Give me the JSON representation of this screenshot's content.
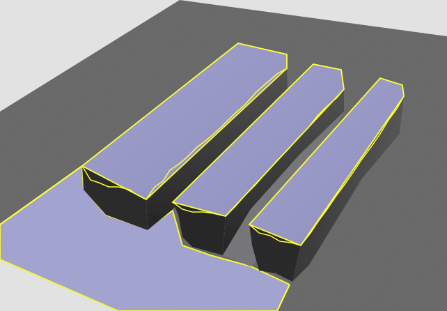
{
  "scene": {
    "background": "#e2e2e2",
    "ground_color": "#6e6e6e",
    "selected_top_color": "#9f9fd0",
    "selected_base_color": "#aaaad8",
    "wall_dark_color": "#2f2f2f",
    "wall_mid_color": "#4a4a4a",
    "outline_color": "#ffff33",
    "objects": [
      {
        "name": "ground-plane",
        "type": "plane",
        "selected": false
      },
      {
        "name": "selected-base-plate",
        "type": "plane",
        "selected": true
      },
      {
        "name": "bar-left",
        "type": "bar",
        "selected": true
      },
      {
        "name": "bar-middle",
        "type": "bar",
        "selected": true
      },
      {
        "name": "bar-right",
        "type": "bar",
        "selected": true
      }
    ]
  }
}
